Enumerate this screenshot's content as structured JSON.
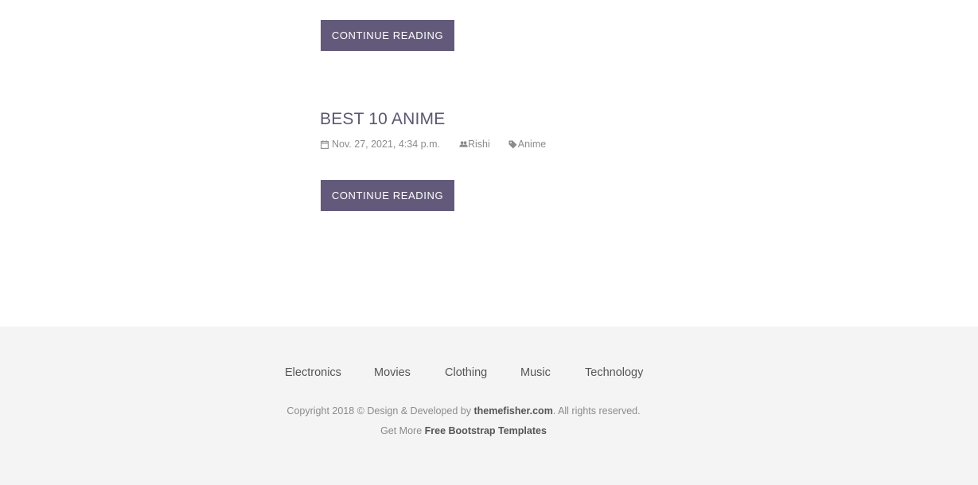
{
  "posts": [
    {
      "continue_label": "CONTINUE READING"
    },
    {
      "title": "BEST 10 ANIME",
      "date": "Nov. 27, 2021, 4:34 p.m.",
      "author": "Rishi",
      "tag": "Anime",
      "continue_label": "CONTINUE READING"
    }
  ],
  "icons": {
    "date": "calendar-icon",
    "author": "users-icon",
    "tag": "tag-icon"
  },
  "footer": {
    "nav": [
      "Electronics",
      "Movies",
      "Clothing",
      "Music",
      "Technology"
    ],
    "copyright_prefix": "Copyright 2018 © Design & Developed by ",
    "copyright_link": "themefisher.com",
    "copyright_suffix": ". All rights reserved.",
    "more_prefix": "Get More ",
    "more_link": "Free Bootstrap Templates"
  },
  "colors": {
    "button": "#635a7b",
    "title": "#5c5872",
    "footer_bg": "#f4f4f4",
    "muted_text": "#8b8b8b"
  }
}
